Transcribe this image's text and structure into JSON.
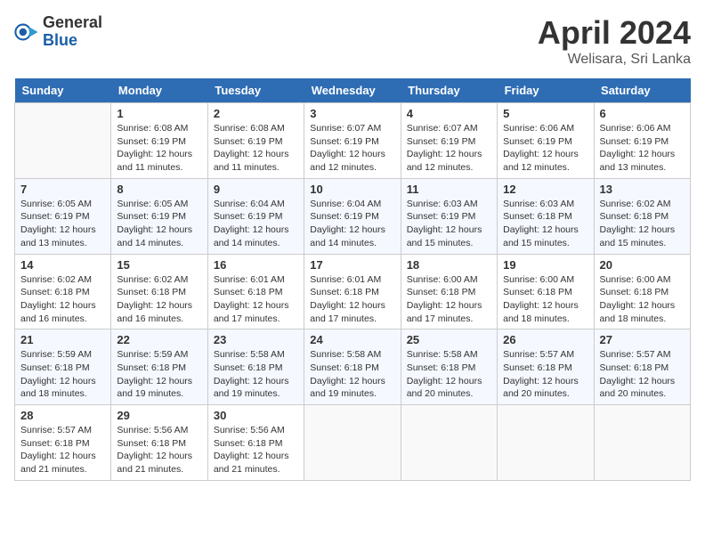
{
  "header": {
    "logo_general": "General",
    "logo_blue": "Blue",
    "month_title": "April 2024",
    "location": "Welisara, Sri Lanka"
  },
  "days_of_week": [
    "Sunday",
    "Monday",
    "Tuesday",
    "Wednesday",
    "Thursday",
    "Friday",
    "Saturday"
  ],
  "weeks": [
    [
      {
        "day": "",
        "info": ""
      },
      {
        "day": "1",
        "info": "Sunrise: 6:08 AM\nSunset: 6:19 PM\nDaylight: 12 hours and 11 minutes."
      },
      {
        "day": "2",
        "info": "Sunrise: 6:08 AM\nSunset: 6:19 PM\nDaylight: 12 hours and 11 minutes."
      },
      {
        "day": "3",
        "info": "Sunrise: 6:07 AM\nSunset: 6:19 PM\nDaylight: 12 hours and 12 minutes."
      },
      {
        "day": "4",
        "info": "Sunrise: 6:07 AM\nSunset: 6:19 PM\nDaylight: 12 hours and 12 minutes."
      },
      {
        "day": "5",
        "info": "Sunrise: 6:06 AM\nSunset: 6:19 PM\nDaylight: 12 hours and 12 minutes."
      },
      {
        "day": "6",
        "info": "Sunrise: 6:06 AM\nSunset: 6:19 PM\nDaylight: 12 hours and 13 minutes."
      }
    ],
    [
      {
        "day": "7",
        "info": "Sunrise: 6:05 AM\nSunset: 6:19 PM\nDaylight: 12 hours and 13 minutes."
      },
      {
        "day": "8",
        "info": "Sunrise: 6:05 AM\nSunset: 6:19 PM\nDaylight: 12 hours and 14 minutes."
      },
      {
        "day": "9",
        "info": "Sunrise: 6:04 AM\nSunset: 6:19 PM\nDaylight: 12 hours and 14 minutes."
      },
      {
        "day": "10",
        "info": "Sunrise: 6:04 AM\nSunset: 6:19 PM\nDaylight: 12 hours and 14 minutes."
      },
      {
        "day": "11",
        "info": "Sunrise: 6:03 AM\nSunset: 6:19 PM\nDaylight: 12 hours and 15 minutes."
      },
      {
        "day": "12",
        "info": "Sunrise: 6:03 AM\nSunset: 6:18 PM\nDaylight: 12 hours and 15 minutes."
      },
      {
        "day": "13",
        "info": "Sunrise: 6:02 AM\nSunset: 6:18 PM\nDaylight: 12 hours and 15 minutes."
      }
    ],
    [
      {
        "day": "14",
        "info": "Sunrise: 6:02 AM\nSunset: 6:18 PM\nDaylight: 12 hours and 16 minutes."
      },
      {
        "day": "15",
        "info": "Sunrise: 6:02 AM\nSunset: 6:18 PM\nDaylight: 12 hours and 16 minutes."
      },
      {
        "day": "16",
        "info": "Sunrise: 6:01 AM\nSunset: 6:18 PM\nDaylight: 12 hours and 17 minutes."
      },
      {
        "day": "17",
        "info": "Sunrise: 6:01 AM\nSunset: 6:18 PM\nDaylight: 12 hours and 17 minutes."
      },
      {
        "day": "18",
        "info": "Sunrise: 6:00 AM\nSunset: 6:18 PM\nDaylight: 12 hours and 17 minutes."
      },
      {
        "day": "19",
        "info": "Sunrise: 6:00 AM\nSunset: 6:18 PM\nDaylight: 12 hours and 18 minutes."
      },
      {
        "day": "20",
        "info": "Sunrise: 6:00 AM\nSunset: 6:18 PM\nDaylight: 12 hours and 18 minutes."
      }
    ],
    [
      {
        "day": "21",
        "info": "Sunrise: 5:59 AM\nSunset: 6:18 PM\nDaylight: 12 hours and 18 minutes."
      },
      {
        "day": "22",
        "info": "Sunrise: 5:59 AM\nSunset: 6:18 PM\nDaylight: 12 hours and 19 minutes."
      },
      {
        "day": "23",
        "info": "Sunrise: 5:58 AM\nSunset: 6:18 PM\nDaylight: 12 hours and 19 minutes."
      },
      {
        "day": "24",
        "info": "Sunrise: 5:58 AM\nSunset: 6:18 PM\nDaylight: 12 hours and 19 minutes."
      },
      {
        "day": "25",
        "info": "Sunrise: 5:58 AM\nSunset: 6:18 PM\nDaylight: 12 hours and 20 minutes."
      },
      {
        "day": "26",
        "info": "Sunrise: 5:57 AM\nSunset: 6:18 PM\nDaylight: 12 hours and 20 minutes."
      },
      {
        "day": "27",
        "info": "Sunrise: 5:57 AM\nSunset: 6:18 PM\nDaylight: 12 hours and 20 minutes."
      }
    ],
    [
      {
        "day": "28",
        "info": "Sunrise: 5:57 AM\nSunset: 6:18 PM\nDaylight: 12 hours and 21 minutes."
      },
      {
        "day": "29",
        "info": "Sunrise: 5:56 AM\nSunset: 6:18 PM\nDaylight: 12 hours and 21 minutes."
      },
      {
        "day": "30",
        "info": "Sunrise: 5:56 AM\nSunset: 6:18 PM\nDaylight: 12 hours and 21 minutes."
      },
      {
        "day": "",
        "info": ""
      },
      {
        "day": "",
        "info": ""
      },
      {
        "day": "",
        "info": ""
      },
      {
        "day": "",
        "info": ""
      }
    ]
  ]
}
